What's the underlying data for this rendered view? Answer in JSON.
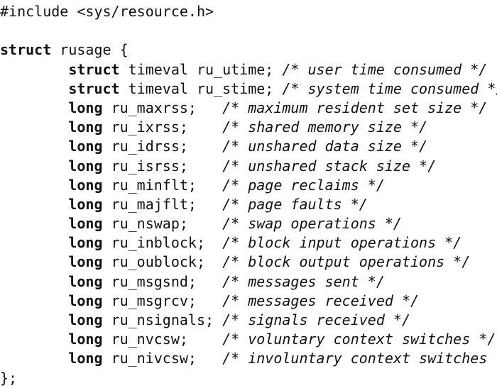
{
  "include_line": "#include <sys/resource.h>",
  "struct_open": {
    "keyword": "struct",
    "name": " rusage {"
  },
  "struct_close": "};",
  "fields": [
    {
      "indent": "        ",
      "type": "struct",
      "rest": " timeval ru_utime; ",
      "comment": "/* user time consumed */"
    },
    {
      "indent": "        ",
      "type": "struct",
      "rest": " timeval ru_stime; ",
      "comment": "/* system time consumed */"
    },
    {
      "indent": "        ",
      "type": "long",
      "rest": " ru_maxrss;   ",
      "comment": "/* maximum resident set size */"
    },
    {
      "indent": "        ",
      "type": "long",
      "rest": " ru_ixrss;    ",
      "comment": "/* shared memory size */"
    },
    {
      "indent": "        ",
      "type": "long",
      "rest": " ru_idrss;    ",
      "comment": "/* unshared data size */"
    },
    {
      "indent": "        ",
      "type": "long",
      "rest": " ru_isrss;    ",
      "comment": "/* unshared stack size */"
    },
    {
      "indent": "        ",
      "type": "long",
      "rest": " ru_minflt;   ",
      "comment": "/* page reclaims */"
    },
    {
      "indent": "        ",
      "type": "long",
      "rest": " ru_majflt;   ",
      "comment": "/* page faults */"
    },
    {
      "indent": "        ",
      "type": "long",
      "rest": " ru_nswap;    ",
      "comment": "/* swap operations */"
    },
    {
      "indent": "        ",
      "type": "long",
      "rest": " ru_inblock;  ",
      "comment": "/* block input operations */"
    },
    {
      "indent": "        ",
      "type": "long",
      "rest": " ru_oublock;  ",
      "comment": "/* block output operations */"
    },
    {
      "indent": "        ",
      "type": "long",
      "rest": " ru_msgsnd;   ",
      "comment": "/* messages sent */"
    },
    {
      "indent": "        ",
      "type": "long",
      "rest": " ru_msgrcv;   ",
      "comment": "/* messages received */"
    },
    {
      "indent": "        ",
      "type": "long",
      "rest": " ru_nsignals; ",
      "comment": "/* signals received */"
    },
    {
      "indent": "        ",
      "type": "long",
      "rest": " ru_nvcsw;    ",
      "comment": "/* voluntary context switches */"
    },
    {
      "indent": "        ",
      "type": "long",
      "rest": " ru_nivcsw;   ",
      "comment": "/* involuntary context switches */"
    }
  ]
}
